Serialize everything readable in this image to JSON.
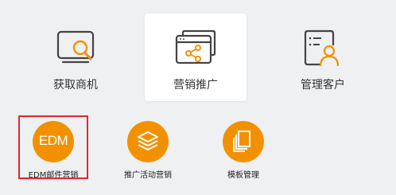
{
  "colors": {
    "accent": "#f29100",
    "icon_stroke": "#444444",
    "highlight_border": "#e0282e",
    "background": "#eff0f2"
  },
  "top_items": [
    {
      "label": "获取商机",
      "icon": "search-monitor-icon",
      "active": false
    },
    {
      "label": "营销推广",
      "icon": "share-window-icon",
      "active": true
    },
    {
      "label": "管理客户",
      "icon": "customer-list-icon",
      "active": false
    }
  ],
  "sub_items": [
    {
      "label": "EDM邮件营销",
      "icon": "edm-icon",
      "icon_text": "EDM",
      "highlighted": true
    },
    {
      "label": "推广活动营销",
      "icon": "layers-icon"
    },
    {
      "label": "模板管理",
      "icon": "template-copy-icon"
    }
  ]
}
